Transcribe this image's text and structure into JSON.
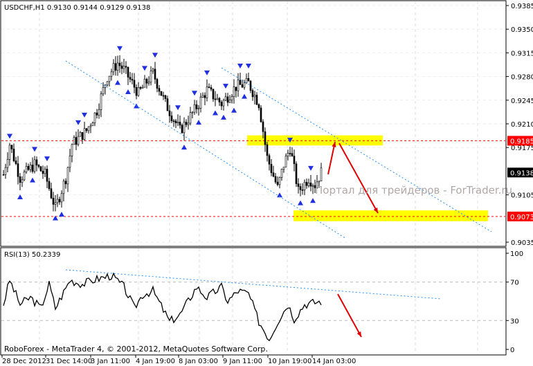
{
  "chart_data": [
    {
      "type": "candlestick",
      "title": "USDCHF,H1  0.9130 0.9144 0.9129 0.9138",
      "symbol": "USDCHF,H1",
      "ohlc_last": {
        "open": 0.913,
        "high": 0.9144,
        "low": 0.9129,
        "close": 0.9138
      },
      "y_ticks": [
        "0.9385",
        "0.9350",
        "0.9315",
        "0.9280",
        "0.9245",
        "0.9210",
        "0.9175",
        "0.9105",
        "0.9035"
      ],
      "ylim": [
        0.9035,
        0.9385
      ],
      "x_ticks": [
        "28 Dec 2012",
        "31 Dec 14:00",
        "3 Jan 11:00",
        "4 Jan 19:00",
        "8 Jan 03:00",
        "9 Jan 11:00",
        "10 Jan 19:00",
        "14 Jan 03:00"
      ],
      "close_keypoints": [
        [
          0,
          0.9135
        ],
        [
          3,
          0.918
        ],
        [
          8,
          0.913
        ],
        [
          15,
          0.915
        ],
        [
          20,
          0.9135
        ],
        [
          25,
          0.9085
        ],
        [
          30,
          0.913
        ],
        [
          33,
          0.918
        ],
        [
          40,
          0.92
        ],
        [
          45,
          0.923
        ],
        [
          50,
          0.928
        ],
        [
          55,
          0.93
        ],
        [
          58,
          0.929
        ],
        [
          65,
          0.9255
        ],
        [
          72,
          0.9285
        ],
        [
          78,
          0.924
        ],
        [
          85,
          0.92
        ],
        [
          92,
          0.923
        ],
        [
          98,
          0.926
        ],
        [
          105,
          0.924
        ],
        [
          112,
          0.9265
        ],
        [
          118,
          0.927
        ],
        [
          123,
          0.924
        ],
        [
          127,
          0.916
        ],
        [
          132,
          0.9115
        ],
        [
          135,
          0.915
        ],
        [
          138,
          0.9175
        ],
        [
          142,
          0.911
        ],
        [
          147,
          0.913
        ],
        [
          150,
          0.912
        ],
        [
          153,
          0.9138
        ]
      ],
      "levels": [
        {
          "label": "0.9185",
          "value": 0.9185,
          "color": "#ff0000"
        },
        {
          "label": "0.9073",
          "value": 0.9073,
          "color": "#ff0000"
        }
      ],
      "current_price": {
        "label": "0.9138",
        "value": 0.9138
      },
      "zones": [
        [
          0.9178,
          0.9193
        ],
        [
          0.9066,
          0.9082
        ]
      ],
      "watermark": "Портал для трейдеров - ForTrader.ru"
    },
    {
      "type": "line",
      "title": "RSI(13) 50.2339",
      "ylim": [
        0,
        100
      ],
      "y_ticks": [
        "100",
        "70",
        "30",
        "0"
      ],
      "levels": [
        70,
        30
      ],
      "keypoints": [
        [
          0,
          47
        ],
        [
          3,
          72
        ],
        [
          8,
          47
        ],
        [
          13,
          54
        ],
        [
          18,
          43
        ],
        [
          22,
          68
        ],
        [
          25,
          43
        ],
        [
          32,
          72
        ],
        [
          38,
          68
        ],
        [
          43,
          72
        ],
        [
          52,
          77
        ],
        [
          58,
          65
        ],
        [
          63,
          43
        ],
        [
          67,
          57
        ],
        [
          72,
          61
        ],
        [
          80,
          29
        ],
        [
          85,
          36
        ],
        [
          88,
          47
        ],
        [
          93,
          65
        ],
        [
          98,
          54
        ],
        [
          105,
          65
        ],
        [
          108,
          50
        ],
        [
          113,
          61
        ],
        [
          118,
          58
        ],
        [
          123,
          29
        ],
        [
          128,
          11
        ],
        [
          132,
          29
        ],
        [
          137,
          47
        ],
        [
          140,
          32
        ],
        [
          145,
          47
        ],
        [
          153,
          50
        ]
      ]
    }
  ],
  "footer": {
    "copyright": "RoboForex - MetaTrader 4, © 2001-2012, MetaQuotes Software Corp."
  },
  "colors": {
    "level": "#ff0000",
    "zone": "#ffff00",
    "trend": "#1e90ff",
    "fractal": "#2030e0",
    "arrow": "#e00000"
  }
}
